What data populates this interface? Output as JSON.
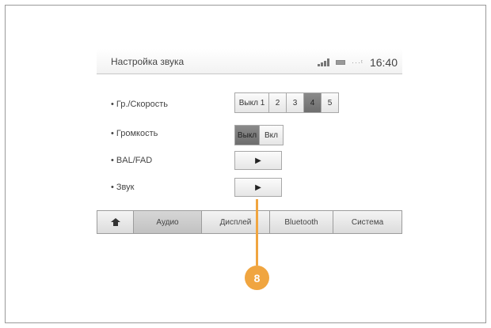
{
  "header": {
    "title": "Настройка звука",
    "time": "16:40",
    "signal_icon": "signal-bars-icon",
    "battery_icon": "battery-icon",
    "network_icon": "network-icon"
  },
  "rows": [
    {
      "label": "• Гр./Скорость"
    },
    {
      "label": "• Громкость"
    },
    {
      "label": "• BAL/FAD"
    },
    {
      "label": "• Звук"
    }
  ],
  "speed_segment": {
    "options": [
      "Выкл 1",
      "2",
      "3",
      "4",
      "5"
    ],
    "selected": "4"
  },
  "volume_segment": {
    "options": [
      "Выкл",
      "Вкл"
    ],
    "selected": "Выкл"
  },
  "arrow_glyph": "▶",
  "tabs": {
    "home_icon": "home-icon",
    "audio": "Аудио",
    "display": "Дисплей",
    "bluetooth": "Bluetooth",
    "system": "Система",
    "active": "Аудио"
  },
  "callout": {
    "number": "8",
    "color": "#f0a540"
  }
}
